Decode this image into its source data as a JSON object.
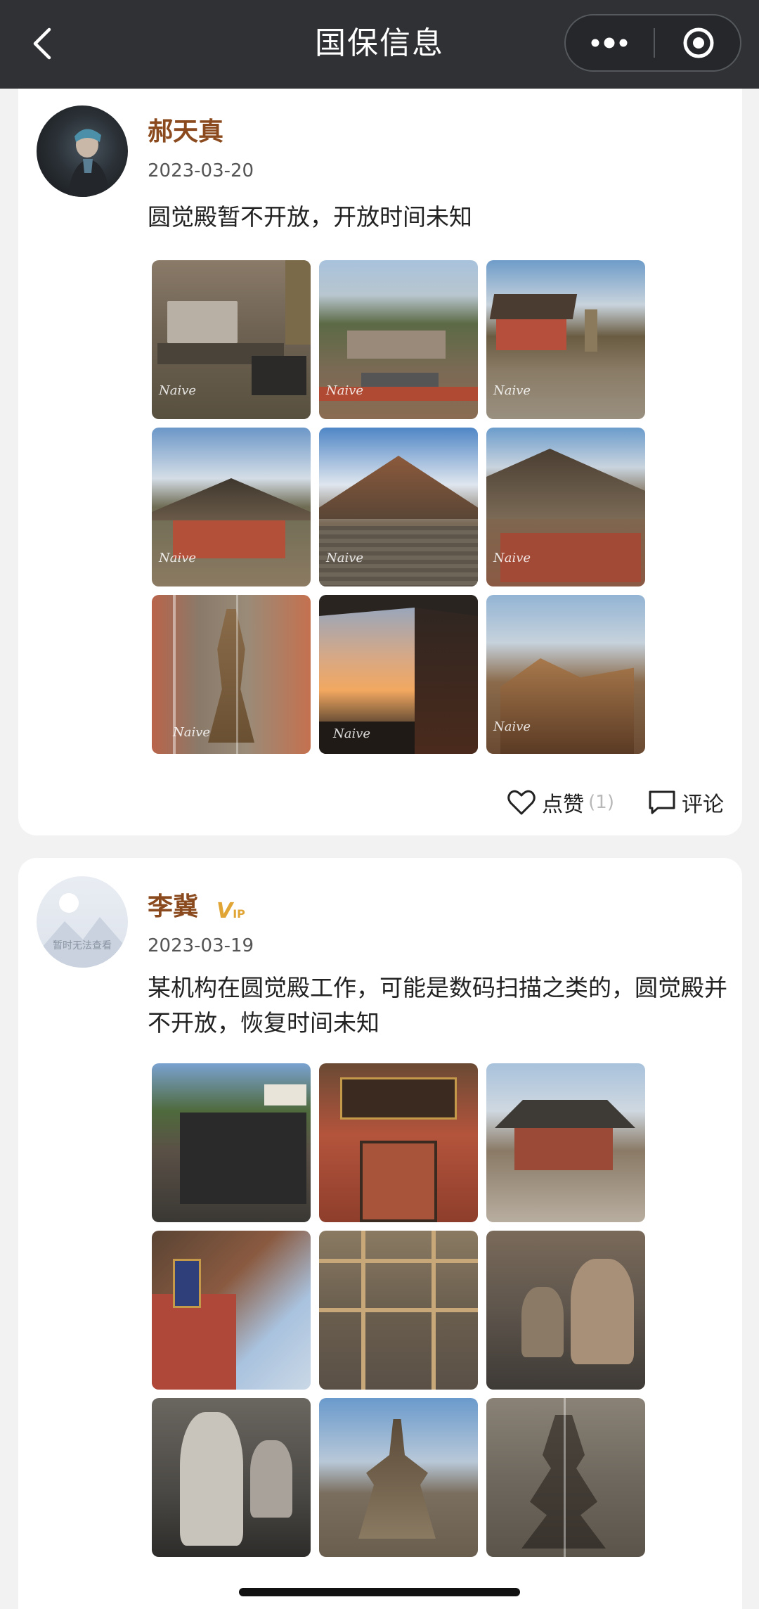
{
  "navbar": {
    "title": "国保信息",
    "icons": {
      "back": "chevron-left-icon",
      "more": "more-dots-icon",
      "close": "target-circle-icon"
    }
  },
  "posts": [
    {
      "username": "郝天真",
      "date": "2023-03-20",
      "content": "圆觉殿暂不开放，开放时间未知",
      "image_watermark": "Naive",
      "likes_label": "点赞",
      "likes_count": "(1)",
      "comment_label": "评论"
    },
    {
      "username": "李冀",
      "vip_badge": "V",
      "vip_badge_suffix": "IP",
      "avatar_placeholder": "暂时无法查看",
      "date": "2023-03-19",
      "content": "某机构在圆觉殿工作，可能是数码扫描之类的，圆觉殿并不开放，恢复时间未知"
    }
  ],
  "colors": {
    "navbar": "#2f3134",
    "username": "#8b4a1e",
    "vip": "#e0a534",
    "page_bg": "#f2f2f2"
  }
}
